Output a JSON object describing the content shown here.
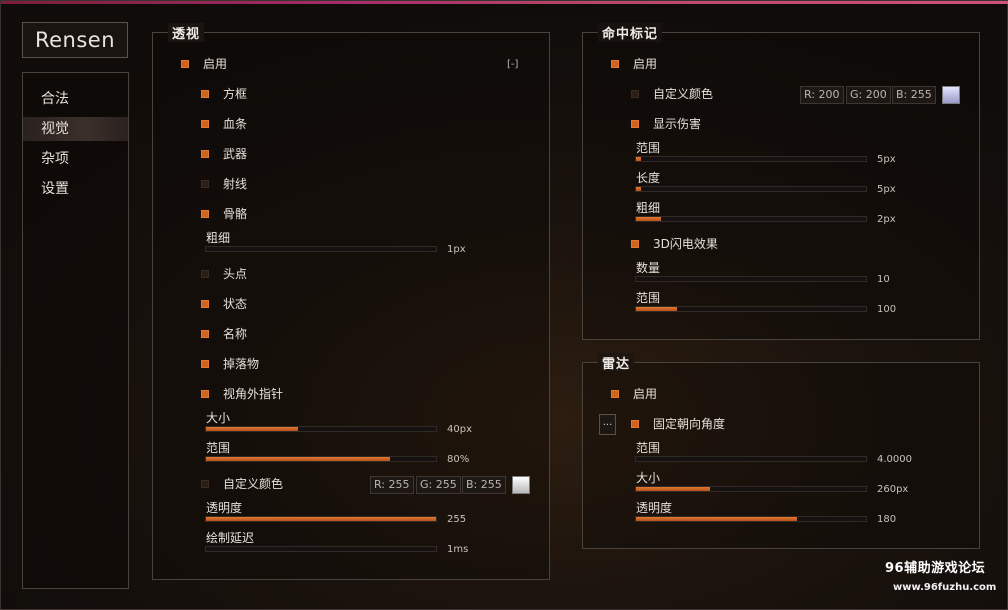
{
  "app": {
    "logo": "Rensen"
  },
  "sidebar": {
    "items": [
      {
        "label": "合法",
        "active": false
      },
      {
        "label": "视觉",
        "active": true
      },
      {
        "label": "杂项",
        "active": false
      },
      {
        "label": "设置",
        "active": false
      }
    ]
  },
  "esp": {
    "title": "透视",
    "enable": {
      "label": "启用",
      "checked": true
    },
    "collapse_label": "[-]",
    "box": {
      "label": "方框",
      "checked": true
    },
    "health": {
      "label": "血条",
      "checked": true
    },
    "weapon": {
      "label": "武器",
      "checked": true
    },
    "snapline": {
      "label": "射线",
      "checked": false
    },
    "skeleton": {
      "label": "骨骼",
      "checked": true
    },
    "thickness": {
      "label": "粗细",
      "value_text": "1px",
      "fill": 0.0
    },
    "head": {
      "label": "头点",
      "checked": false
    },
    "status": {
      "label": "状态",
      "checked": true
    },
    "name": {
      "label": "名称",
      "checked": true
    },
    "drops": {
      "label": "掉落物",
      "checked": true
    },
    "offscreen": {
      "label": "视角外指针",
      "checked": true
    },
    "size": {
      "label": "大小",
      "value_text": "40px",
      "fill": 0.4
    },
    "range": {
      "label": "范围",
      "value_text": "80%",
      "fill": 0.8
    },
    "custom_color": {
      "label": "自定义颜色",
      "checked": false,
      "r": "R: 255",
      "g": "G: 255",
      "b": "B: 255",
      "swatch": "#ffffff"
    },
    "opacity": {
      "label": "透明度",
      "value_text": "255",
      "fill": 1.0
    },
    "draw_delay": {
      "label": "绘制延迟",
      "value_text": "1ms",
      "fill": 0.0
    }
  },
  "hitmarker": {
    "title": "命中标记",
    "enable": {
      "label": "启用",
      "checked": true
    },
    "custom_color": {
      "label": "自定义颜色",
      "checked": false,
      "r": "R: 200",
      "g": "G: 200",
      "b": "B: 255",
      "swatch": "#c8c8ff"
    },
    "show_damage": {
      "label": "显示伤害",
      "checked": true
    },
    "range": {
      "label": "范围",
      "value_text": "5px",
      "fill": 0.02
    },
    "length": {
      "label": "长度",
      "value_text": "5px",
      "fill": 0.02
    },
    "thickness": {
      "label": "粗细",
      "value_text": "2px",
      "fill": 0.11
    },
    "lightning": {
      "label": "3D闪电效果",
      "checked": true
    },
    "count": {
      "label": "数量",
      "value_text": "10",
      "fill": 0.0
    },
    "range2": {
      "label": "范围",
      "value_text": "100",
      "fill": 0.18
    }
  },
  "radar": {
    "title": "雷达",
    "enable": {
      "label": "启用",
      "checked": true
    },
    "more_button": "...",
    "fixed_orientation": {
      "label": "固定朝向角度",
      "checked": true
    },
    "range": {
      "label": "范围",
      "value_text": "4.0000",
      "fill": 0.0
    },
    "size": {
      "label": "大小",
      "value_text": "260px",
      "fill": 0.32
    },
    "opacity": {
      "label": "透明度",
      "value_text": "180",
      "fill": 0.7
    }
  },
  "watermark": {
    "line1": "96辅助游戏论坛",
    "line2": "www.96fuzhu.com"
  },
  "colors": {
    "accent": "#d2621f",
    "accent_line": "#a52d6b"
  }
}
